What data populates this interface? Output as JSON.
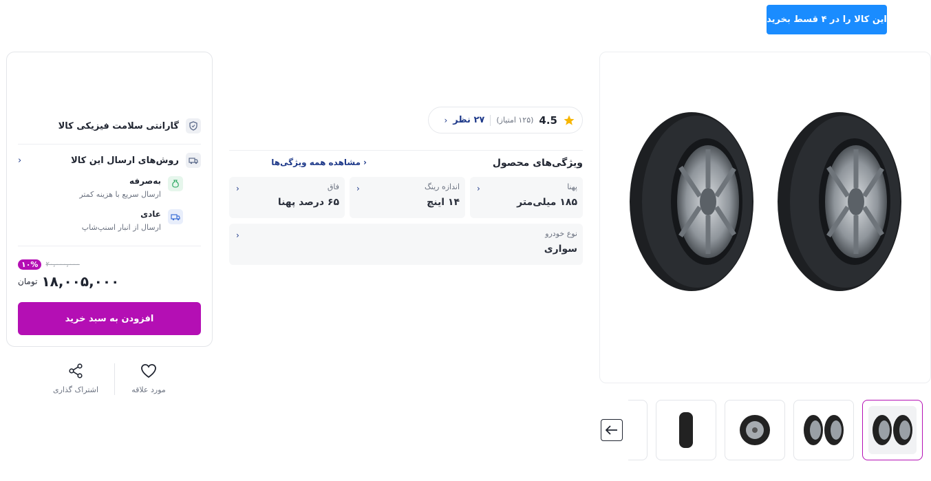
{
  "installment_banner": "این کالا را در ۴ قسط بخرید",
  "rating": {
    "score": "4.5",
    "count_text": "(۱۲۵ امتیاز)",
    "reviews_text": "۲۷ نظر"
  },
  "specs": {
    "title": "ویژگی‌های محصول",
    "see_all": "مشاهده همه ویژگی‌ها",
    "items": [
      {
        "label": "پهنا",
        "value": "۱۸۵ میلی‌متر"
      },
      {
        "label": "اندازه رینگ",
        "value": "۱۴ اینچ"
      },
      {
        "label": "فاق",
        "value": "۶۵ درصد پهنا"
      },
      {
        "label": "نوع خودرو",
        "value": "سواری"
      }
    ]
  },
  "buybox": {
    "warranty": "گارانتی سلامت فیزیکی کالا",
    "shipping_title": "روش‌های ارسال این کالا",
    "shipping_options": [
      {
        "title": "به‌صرفه",
        "desc": "ارسال سریع با هزینه کمتر"
      },
      {
        "title": "عادی",
        "desc": "ارسال از انبار اسنپ‌شاپ"
      }
    ],
    "discount": "۱۰%",
    "old_price": "۲۰,۰۰۰,۰۰۰",
    "price": "۱۸,۰۰۵,۰۰۰",
    "currency": "تومان",
    "add_to_cart": "افزودن به سبد خرید"
  },
  "actions": {
    "favorite": "مورد علاقه",
    "share": "اشتراک گذاری"
  },
  "colors": {
    "accent": "#b40fb4",
    "banner": "#1a8cff",
    "link": "#1f3a8a"
  }
}
